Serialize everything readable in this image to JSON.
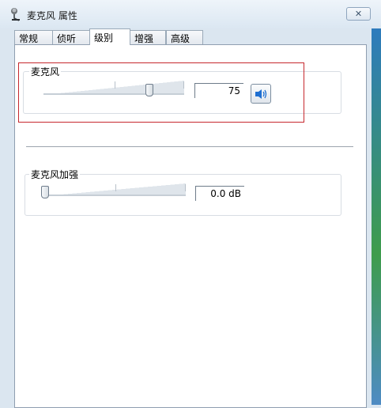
{
  "window": {
    "title": "麦克风 属性",
    "close_label": "✕"
  },
  "tabs": [
    {
      "label": "常规",
      "active": false
    },
    {
      "label": "侦听",
      "active": false
    },
    {
      "label": "级别",
      "active": true
    },
    {
      "label": "增强",
      "active": false
    },
    {
      "label": "高级",
      "active": false
    }
  ],
  "microphone": {
    "label": "麦克风",
    "level": 75,
    "value_text": "75",
    "mute_icon": "speaker-icon",
    "highlighted": true
  },
  "boost": {
    "label": "麦克风加强",
    "level_db": 0.0,
    "value_text": "0.0 dB"
  },
  "colors": {
    "highlight": "#c6282e",
    "accent": "#1f6fd1"
  }
}
